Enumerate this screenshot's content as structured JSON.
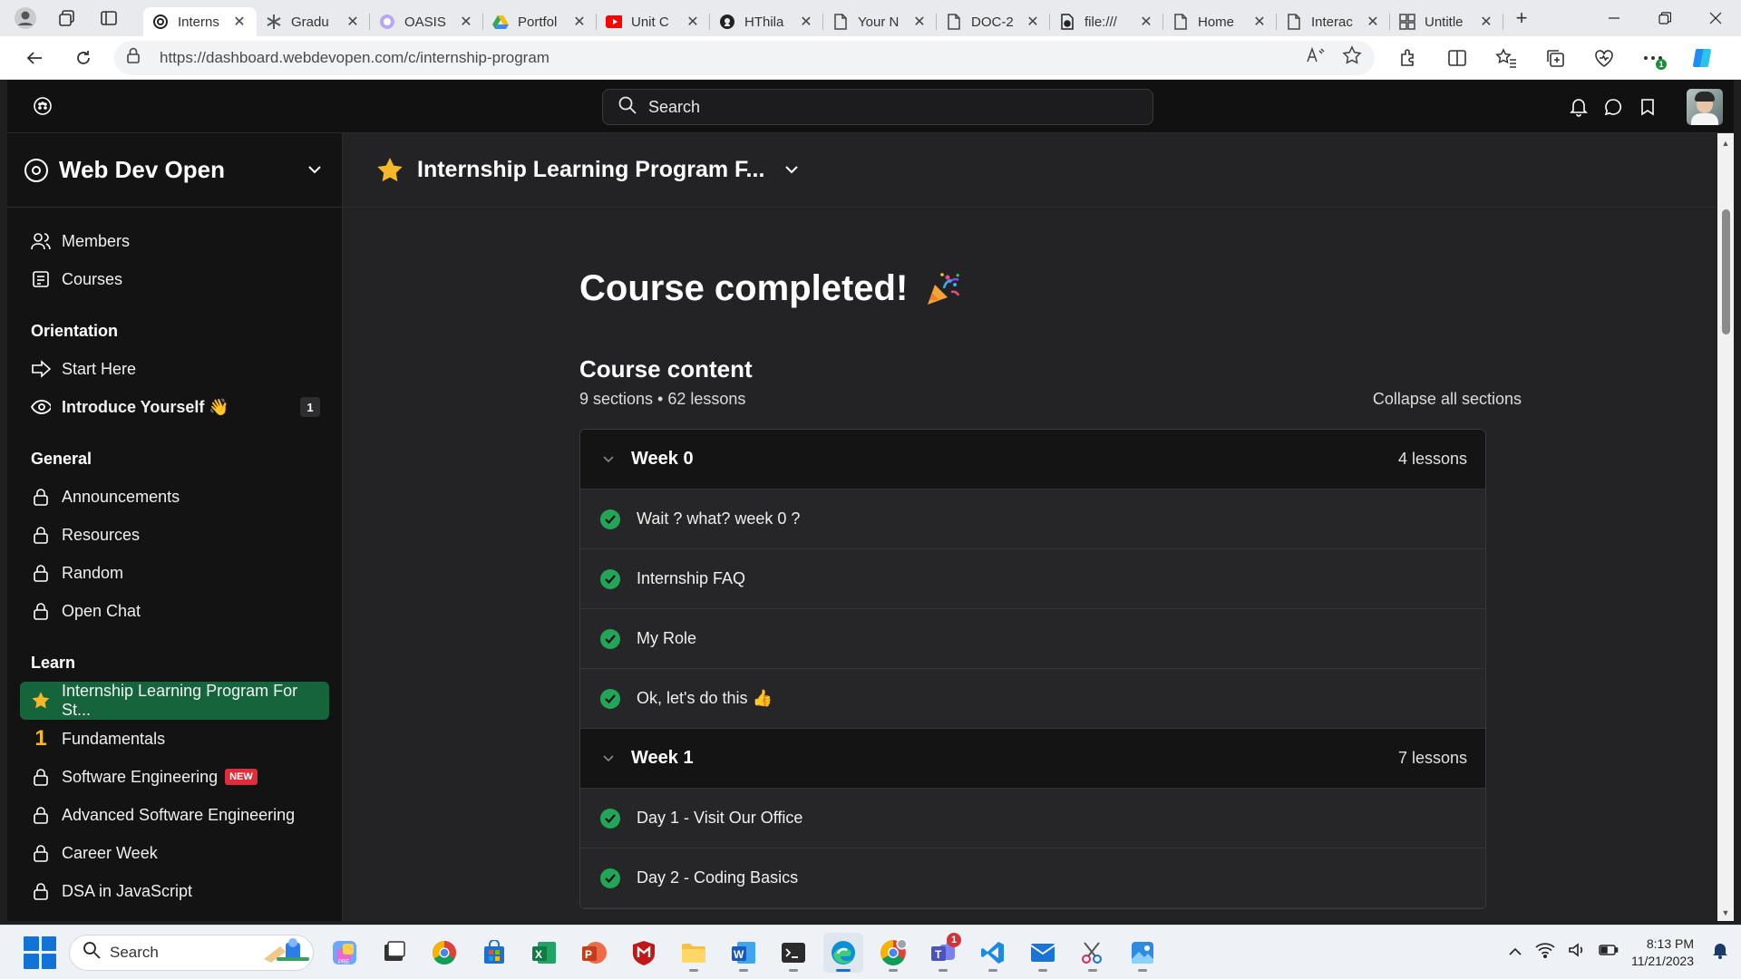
{
  "browser": {
    "tabs": [
      {
        "title": "Interns",
        "icon": "webdevopen-icon",
        "active": true
      },
      {
        "title": "Gradu",
        "icon": "asterisk-icon"
      },
      {
        "title": "OASIS",
        "icon": "oasis-icon"
      },
      {
        "title": "Portfol",
        "icon": "drive-icon"
      },
      {
        "title": "Unit C",
        "icon": "youtube-icon"
      },
      {
        "title": "HThila",
        "icon": "github-icon"
      },
      {
        "title": "Your N",
        "icon": "page-icon"
      },
      {
        "title": "DOC-2",
        "icon": "page-icon"
      },
      {
        "title": "file:///",
        "icon": "file-icon"
      },
      {
        "title": "Home",
        "icon": "page-icon"
      },
      {
        "title": "Interac",
        "icon": "page-icon"
      },
      {
        "title": "Untitle",
        "icon": "grid-icon"
      }
    ],
    "url": "https://dashboard.webdevopen.com/c/internship-program",
    "extension_badge": "1"
  },
  "site": {
    "search_placeholder": "Search",
    "space_name": "Web Dev Open"
  },
  "sidebar": {
    "top_items": [
      {
        "label": "Members",
        "icon": "members-icon"
      },
      {
        "label": "Courses",
        "icon": "courses-icon"
      }
    ],
    "groups": [
      {
        "title": "Orientation",
        "items": [
          {
            "label": "Start Here",
            "icon": "arrow-right-icon"
          },
          {
            "label": "Introduce Yourself 👋",
            "icon": "eye-icon",
            "count": "1"
          }
        ]
      },
      {
        "title": "General",
        "items": [
          {
            "label": "Announcements",
            "icon": "lock-icon"
          },
          {
            "label": "Resources",
            "icon": "lock-icon"
          },
          {
            "label": "Random",
            "icon": "lock-icon"
          },
          {
            "label": "Open Chat",
            "icon": "lock-icon"
          }
        ]
      },
      {
        "title": "Learn",
        "items": [
          {
            "label": "Internship Learning Program For St...",
            "icon": "star-icon"
          },
          {
            "label": "Fundamentals",
            "icon": "number-one-icon"
          },
          {
            "label": "Software Engineering",
            "icon": "lock-icon",
            "badge": "NEW"
          },
          {
            "label": "Advanced Software Engineering",
            "icon": "lock-icon"
          },
          {
            "label": "Career Week",
            "icon": "lock-icon"
          },
          {
            "label": "DSA in JavaScript",
            "icon": "lock-icon"
          }
        ]
      }
    ]
  },
  "main": {
    "course_title": "Internship Learning Program F...",
    "completed_heading": "Course completed!",
    "content_heading": "Course content",
    "content_meta": "9 sections • 62 lessons",
    "collapse_label": "Collapse all sections",
    "sections": [
      {
        "title": "Week 0",
        "count": "4 lessons",
        "lessons": [
          "Wait ? what? week 0 ?",
          "Internship FAQ",
          "My Role",
          "Ok, let's do this 👍"
        ]
      },
      {
        "title": "Week 1",
        "count": "7 lessons",
        "lessons": [
          "Day 1 - Visit Our Office",
          "Day 2 - Coding Basics"
        ]
      }
    ]
  },
  "taskbar": {
    "search_label": "Search",
    "time": "8:13 PM",
    "date": "11/21/2023",
    "teams_badge": "1"
  },
  "colors": {
    "active_item": "#16643c",
    "check": "#22a559",
    "new_badge": "#e02d3c",
    "star": "#f5b827"
  }
}
